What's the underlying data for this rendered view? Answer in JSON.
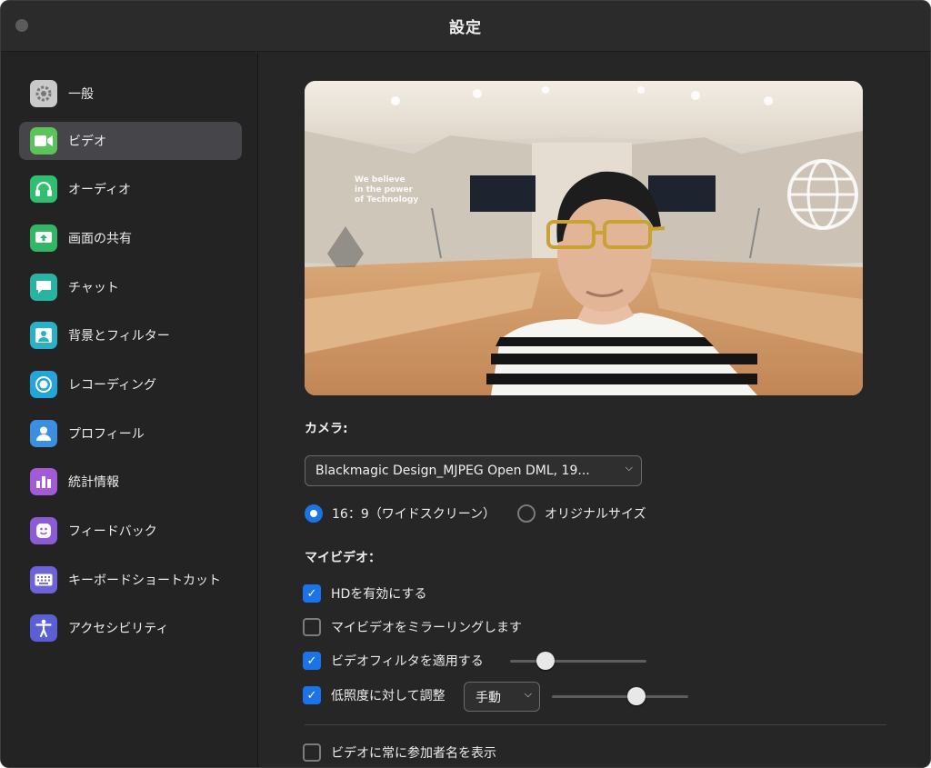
{
  "window": {
    "title": "設定"
  },
  "sidebar": {
    "items": [
      {
        "label": "一般",
        "icon": "gear-icon",
        "color": "#c8c8c8"
      },
      {
        "label": "ビデオ",
        "icon": "video-camera-icon",
        "color": "#5cc35b",
        "active": true
      },
      {
        "label": "オーディオ",
        "icon": "headphones-icon",
        "color": "#2fbf71"
      },
      {
        "label": "画面の共有",
        "icon": "share-screen-icon",
        "color": "#32b864"
      },
      {
        "label": "チャット",
        "icon": "chat-bubble-icon",
        "color": "#28b3a3"
      },
      {
        "label": "背景とフィルター",
        "icon": "background-person-icon",
        "color": "#2bb0c7"
      },
      {
        "label": "レコーディング",
        "icon": "record-icon",
        "color": "#23a5d9"
      },
      {
        "label": "プロフィール",
        "icon": "profile-icon",
        "color": "#3b8fe0"
      },
      {
        "label": "統計情報",
        "icon": "statistics-icon",
        "color": "#a45ad6"
      },
      {
        "label": "フィードバック",
        "icon": "smiley-icon",
        "color": "#8e5ad8"
      },
      {
        "label": "キーボードショートカット",
        "icon": "keyboard-icon",
        "color": "#6d63d9"
      },
      {
        "label": "アクセシビリティ",
        "icon": "accessibility-icon",
        "color": "#5b5fd6"
      }
    ]
  },
  "camera": {
    "section_label": "カメラ:",
    "selected_device": "Blackmagic Design_MJPEG Open DML, 19...",
    "aspect_options": [
      {
        "label": "16：9（ワイドスクリーン）",
        "selected": true
      },
      {
        "label": "オリジナルサイズ",
        "selected": false
      }
    ]
  },
  "preview_sign": {
    "line1": "We believe",
    "line2": "in the power",
    "line3": "of Technology"
  },
  "my_video": {
    "section_label": "マイビデオ：",
    "options": [
      {
        "label": "HDを有効にする",
        "checked": true
      },
      {
        "label": "マイビデオをミラーリングします",
        "checked": false
      },
      {
        "label": "ビデオフィルタを適用する",
        "checked": true,
        "slider_level": 0.22
      },
      {
        "label": "低照度に対して調整",
        "checked": true,
        "mode": "手動",
        "slider_level": 0.64
      }
    ]
  },
  "display_names": {
    "label": "ビデオに常に参加者名を表示",
    "checked": false
  },
  "colors": {
    "accent": "#1a73e8",
    "window_bg": "#262626",
    "sidebar_active": "#46464a"
  }
}
